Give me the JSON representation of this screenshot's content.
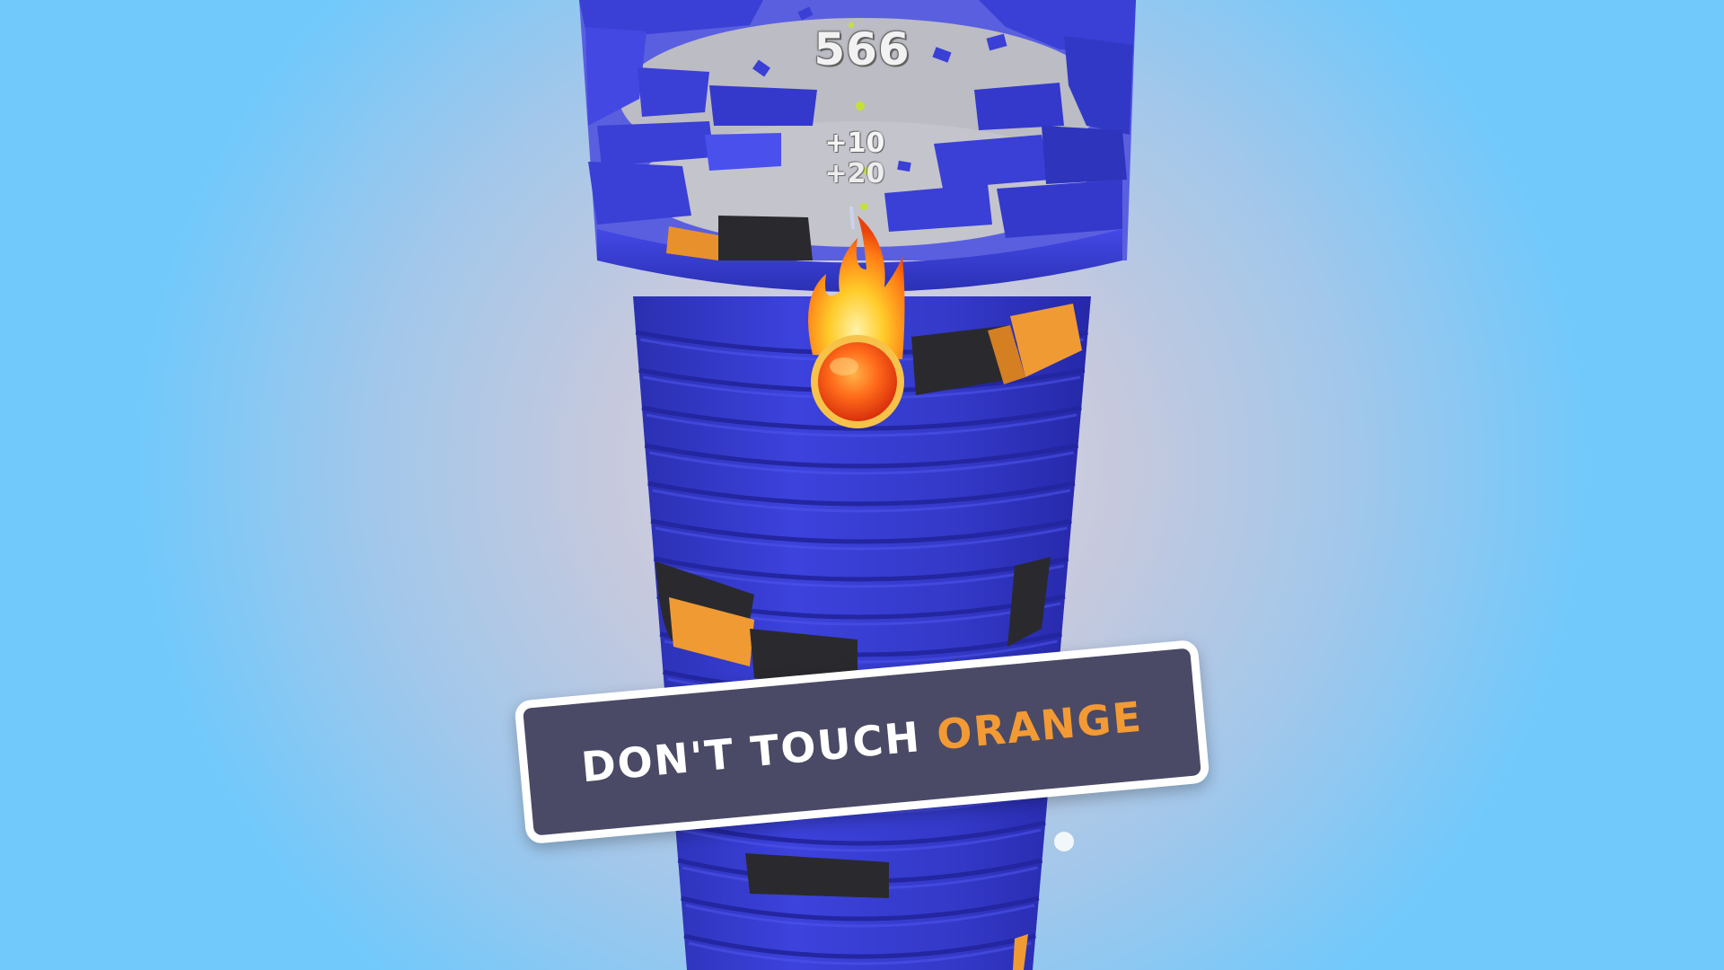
{
  "hud": {
    "score": "566",
    "score_popups": [
      "+10",
      "+20"
    ]
  },
  "hint": {
    "prefix": "DON'T TOUCH",
    "highlight": "ORANGE"
  },
  "colors": {
    "tower_blue": "#3a3fd6",
    "danger_orange": "#f39a34",
    "danger_black": "#2a2a2e",
    "banner_bg": "#4a4a66",
    "sky": "#71c9fb"
  },
  "icons": {
    "player": "fireball-icon",
    "fragment": "debris-icon"
  }
}
